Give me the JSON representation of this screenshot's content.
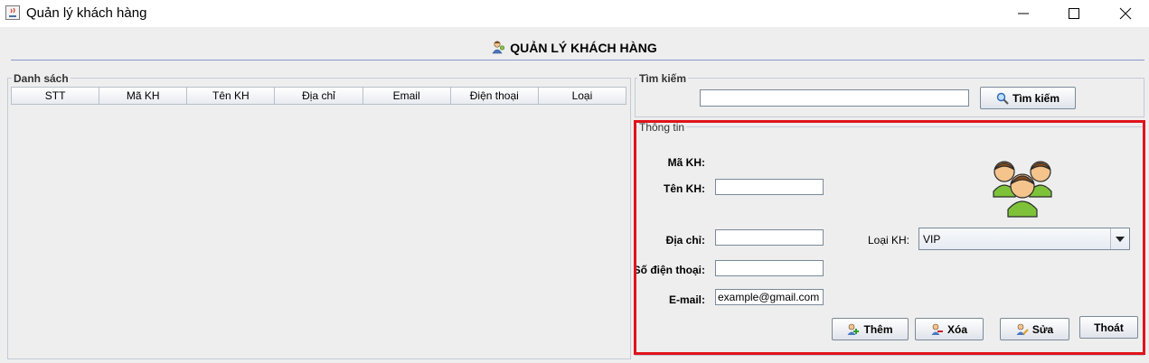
{
  "window": {
    "title": "Quản lý khách hàng"
  },
  "header": {
    "title": "QUẢN LÝ KHÁCH HÀNG",
    "icon": "customer-icon"
  },
  "list_panel": {
    "label": "Danh sách",
    "columns": [
      "STT",
      "Mã KH",
      "Tên KH",
      "Địa chỉ",
      "Email",
      "Điện thoại",
      "Loại"
    ],
    "rows": []
  },
  "search_panel": {
    "label": "Tìm kiếm",
    "input_value": "",
    "button_label": "Tìm kiếm"
  },
  "info_panel": {
    "label": "Thông tin",
    "fields": {
      "ma_kh_label": "Mã KH:",
      "ma_kh_value": "",
      "ten_kh_label": "Tên KH:",
      "ten_kh_value": "",
      "dia_chi_label": "Địa chỉ:",
      "dia_chi_value": "",
      "sdt_label": "Số điện thoại:",
      "sdt_value": "",
      "email_label": "E-mail:",
      "email_value": "example@gmail.com",
      "loai_label": "Loại KH:",
      "loai_value": "VIP"
    },
    "buttons": {
      "add": "Thêm",
      "delete": "Xóa",
      "edit": "Sửa",
      "exit": "Thoát"
    }
  },
  "colors": {
    "highlight": "#e0131b",
    "header_line": "#8a9ac8",
    "background": "#eeeeee"
  }
}
